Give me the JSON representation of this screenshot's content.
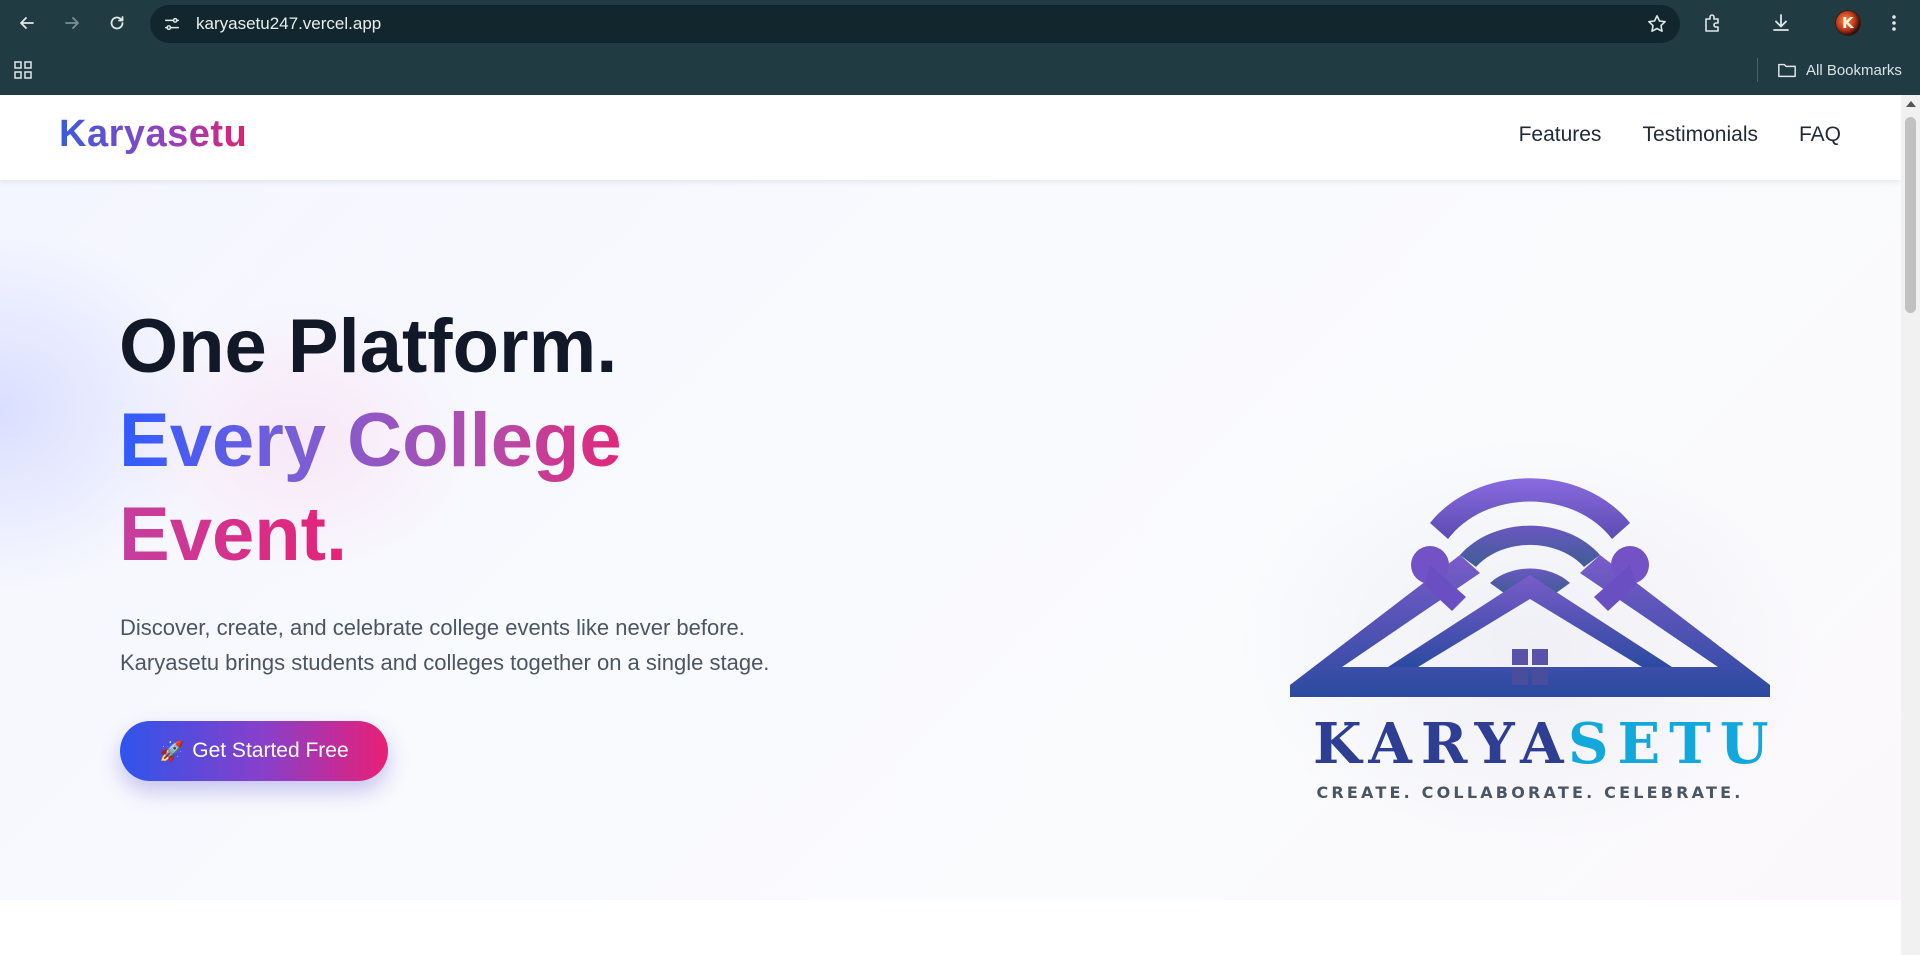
{
  "browser": {
    "url": "karyasetu247.vercel.app",
    "bookmarks_label": "All Bookmarks",
    "avatar_letter": "K"
  },
  "site": {
    "brand": "Karyasetu",
    "nav": [
      "Features",
      "Testimonials",
      "FAQ"
    ]
  },
  "hero": {
    "headline_line1": "One Platform.",
    "headline_line2": "Every College",
    "headline_line3": "Event.",
    "subtext_line1": "Discover, create, and celebrate college events like never before.",
    "subtext_line2": "Karyasetu brings students and colleges together on a single stage.",
    "cta_icon": "🚀",
    "cta_label": "Get Started Free"
  },
  "logo": {
    "word_part1": "KARYA",
    "word_part2": "SETU",
    "tagline": "CREATE. COLLABORATE. CELEBRATE."
  },
  "colors": {
    "chrome_bg": "#213b42",
    "brand_blue": "#2f54eb",
    "brand_pink": "#ea1f75",
    "logo_navy": "#2e3e93",
    "logo_cyan": "#13a8dc"
  }
}
